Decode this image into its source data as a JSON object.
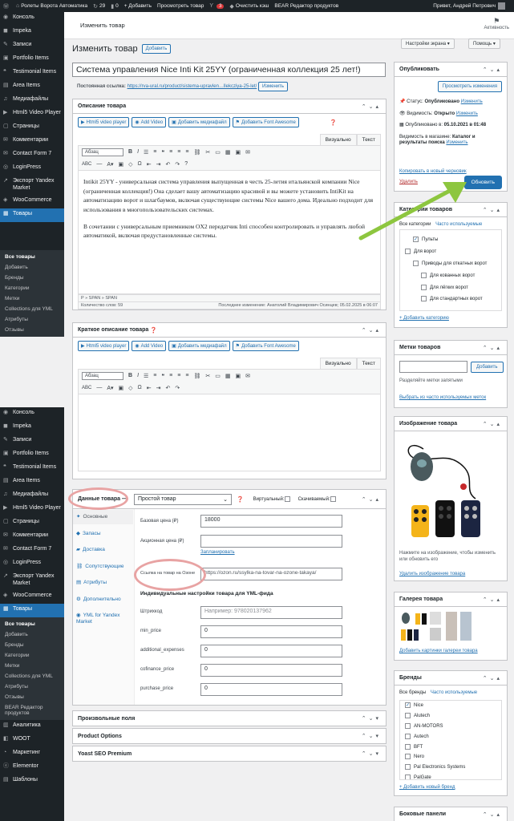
{
  "adminbar": {
    "site": "Ролеты Ворота Автоматика",
    "updates": "29",
    "comments": "0",
    "add": "+ Добавить",
    "view": "Просмотреть товар",
    "yoast_count": "3",
    "cache": "Очистить кэш",
    "bear": "BEAR Редактор продуктов",
    "greeting": "Привет, Андрей Петрович"
  },
  "menu_top": [
    {
      "icon": "◉",
      "label": "Консоль"
    },
    {
      "icon": "◼",
      "label": "Impeka"
    },
    {
      "icon": "✎",
      "label": "Записи"
    },
    {
      "icon": "▣",
      "label": "Portfolio Items"
    },
    {
      "icon": "❝",
      "label": "Testimonial Items"
    },
    {
      "icon": "▤",
      "label": "Area Items"
    },
    {
      "icon": "♫",
      "label": "Медиафайлы"
    },
    {
      "icon": "▶",
      "label": "Html5 Video Player"
    },
    {
      "icon": "▢",
      "label": "Страницы"
    },
    {
      "icon": "✉",
      "label": "Комментарии"
    },
    {
      "icon": "✉",
      "label": "Contact Form 7"
    },
    {
      "icon": "◎",
      "label": "LoginPress"
    },
    {
      "icon": "↗",
      "label": "Экспорт Yandex Market"
    },
    {
      "icon": "◈",
      "label": "WooCommerce"
    },
    {
      "icon": "▦",
      "label": "Товары"
    }
  ],
  "menu_top_sub": [
    "Все товары",
    "Добавить",
    "Бренды",
    "Категории",
    "Метки",
    "Collections для YML",
    "Атрибуты",
    "Отзывы"
  ],
  "menu_bottom": [
    {
      "icon": "◉",
      "label": "Консоль"
    },
    {
      "icon": "◼",
      "label": "Impeka"
    },
    {
      "icon": "✎",
      "label": "Записи"
    },
    {
      "icon": "▣",
      "label": "Portfolio Items"
    },
    {
      "icon": "❝",
      "label": "Testimonial Items"
    },
    {
      "icon": "▤",
      "label": "Area Items"
    },
    {
      "icon": "♫",
      "label": "Медиафайлы"
    },
    {
      "icon": "▶",
      "label": "Html5 Video Player"
    },
    {
      "icon": "▢",
      "label": "Страницы"
    },
    {
      "icon": "✉",
      "label": "Комментарии"
    },
    {
      "icon": "✉",
      "label": "Contact Form 7"
    },
    {
      "icon": "◎",
      "label": "LoginPress"
    },
    {
      "icon": "↗",
      "label": "Экспорт Yandex Market"
    },
    {
      "icon": "◈",
      "label": "WooCommerce"
    },
    {
      "icon": "▦",
      "label": "Товары"
    }
  ],
  "menu_bottom_sub": [
    "Все товары",
    "Добавить",
    "Бренды",
    "Категории",
    "Метки",
    "Collections для YML",
    "Атрибуты",
    "Отзывы",
    "BEAR Редактор продуктов"
  ],
  "menu_bottom_extra": [
    {
      "icon": "▥",
      "label": "Аналитика"
    },
    {
      "icon": "◧",
      "label": "WOOT"
    },
    {
      "icon": "◔",
      "label": "Маркетинг"
    },
    {
      "icon": "ⓔ",
      "label": "Elementor"
    },
    {
      "icon": "▤",
      "label": "Шаблоны"
    }
  ],
  "page": {
    "header": "Изменить товар",
    "activity": "Активность",
    "screen_options": "Настройки экрана ▾",
    "help": "Помощь ▾",
    "title": "Изменить товар",
    "add_btn": "Добавить",
    "product_title": "Система управления  Nice Inti Kit 25YY (ограниченная коллекция 25 лет!)",
    "permalink_label": "Постоянная ссылка:",
    "permalink_url": "https://rva-ural.ru/product/sistema-upravlen…llekcziya-25-let/",
    "change_btn": "Изменить"
  },
  "desc": {
    "title": "Описание товара",
    "buttons": [
      "Html5 video player",
      "Add Video",
      "Добавить медиафайл",
      "Добавить Font Awesome"
    ],
    "tab_visual": "Визуально",
    "tab_text": "Текст",
    "format": "Абзац",
    "p1": "Intikit 25YY - универсальная система управления выпущенная в честь 25-летия итальянской компании Nice (ограниченная коллекция!) Она сделает вашу автоматизацию красивой и вы можете установить IntiKit на автоматизацию ворот и шлагбаумов, включая существующие системы Nice вашего дома. Идеально подходит для использования в многопользовательских системах.",
    "p2": "В сочетании с универсальным приемником OX2 передатчик Inti способен контролировать и управлять любой автоматикой, включая предустановленные системы.",
    "path": "P » SPAN » SPAN",
    "wordcount": "Количество слов: 59",
    "lastedit": "Последнее изменение: Анатолий Владимирович Осинцев; 05.02.2025 в 06:07"
  },
  "short": {
    "title": "Краткое описание товара",
    "buttons": [
      "Html5 video player",
      "Add Video",
      "Добавить медиафайл",
      "Добавить Font Awesome"
    ],
    "tab_visual": "Визуально",
    "tab_text": "Текст",
    "format": "Абзац"
  },
  "product_data": {
    "title": "Данные товара —",
    "type": "Простой товар",
    "virtual": "Виртуальный:",
    "downloadable": "Скачиваемый:",
    "tabs": [
      {
        "icon": "✦",
        "label": "Основные"
      },
      {
        "icon": "◆",
        "label": "Запасы"
      },
      {
        "icon": "▰",
        "label": "Доставка"
      },
      {
        "icon": "⛓",
        "label": "Сопутствующие"
      },
      {
        "icon": "▤",
        "label": "Атрибуты"
      },
      {
        "icon": "⚙",
        "label": "Дополнительно"
      },
      {
        "icon": "◉",
        "label": "YML for Yandex Market"
      }
    ],
    "regular_price_label": "Базовая цена (₽)",
    "regular_price": "18000",
    "sale_price_label": "Акционная цена (₽)",
    "schedule": "Запланировать",
    "ozon_label": "Ссылка на товар на Озоне",
    "ozon_value": "https://ozon.ru/ssylka-na-tovar-na-ozone-takaya/",
    "yml_heading": "Индивидуальные настройки товара для YML-фида",
    "barcode_label": "Штрихкод",
    "barcode_placeholder": "Например: 978020137962",
    "min_price_label": "min_price",
    "min_price": "0",
    "additional_expenses_label": "additional_expenses",
    "additional_expenses": "0",
    "cofinance_label": "cofinance_price",
    "cofinance": "0",
    "purchase_label": "purchase_price",
    "purchase": "0"
  },
  "collapsed_boxes": [
    "Произвольные поля",
    "Product Options",
    "Yoast SEO Premium"
  ],
  "publish": {
    "title": "Опубликовать",
    "preview": "Просмотреть изменения",
    "status": "Статус: ",
    "status_val": "Опубликовано",
    "visibility": "Видимость: ",
    "visibility_val": "Открыто",
    "published": "Опубликовано в: ",
    "published_val": "05.10.2021 в 01:48",
    "catalog": "Видимость в магазине: ",
    "catalog_val": "Каталог и результаты поиска",
    "change": "Изменить",
    "copy": "Копировать в новый черновик",
    "delete": "Удалить",
    "update": "Обновить"
  },
  "categories": {
    "title": "Категории товаров",
    "tab_all": "Все категории",
    "tab_used": "Часто используемые",
    "items": [
      {
        "label": "Пульты",
        "checked": true,
        "level": 1
      },
      {
        "label": "Для ворот",
        "checked": false,
        "level": 0
      },
      {
        "label": "Приводы для откатных ворот",
        "checked": false,
        "level": 1
      },
      {
        "label": "Для кованных ворот",
        "checked": false,
        "level": 2
      },
      {
        "label": "Для лёгких ворот",
        "checked": false,
        "level": 2
      },
      {
        "label": "Для стандартных ворот",
        "checked": false,
        "level": 2
      }
    ],
    "add": "+ Добавить категорию"
  },
  "tags": {
    "title": "Метки товаров",
    "add": "Добавить",
    "hint": "Разделяйте метки запятыми",
    "choose": "Выбрать из часто используемых меток"
  },
  "image": {
    "title": "Изображение товара",
    "hint": "Нажмите на изображение, чтобы изменить или обновить его",
    "remove": "Удалить изображение товара"
  },
  "gallery": {
    "title": "Галерея товара",
    "add": "Добавить картинки галереи товара"
  },
  "brands": {
    "title": "Бренды",
    "tab_all": "Все бренды",
    "tab_used": "Часто используемые",
    "items": [
      {
        "label": "Nice",
        "checked": true
      },
      {
        "label": "Alutech",
        "checked": false
      },
      {
        "label": "AN-MOTORS",
        "checked": false
      },
      {
        "label": "Autech",
        "checked": false
      },
      {
        "label": "BFT",
        "checked": false
      },
      {
        "label": "Nero",
        "checked": false
      },
      {
        "label": "Pal Electronics Systems",
        "checked": false
      },
      {
        "label": "PalGate",
        "checked": false
      }
    ],
    "add": "+ Добавить новый бренд"
  },
  "side_panels": "Боковые панели"
}
